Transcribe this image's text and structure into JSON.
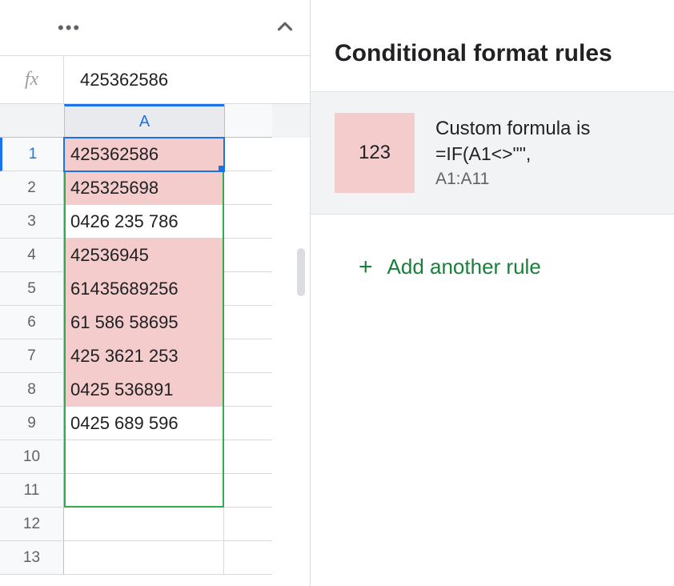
{
  "formula_bar": {
    "fx_label": "fx",
    "value": "425362586"
  },
  "columns": [
    "A"
  ],
  "rows": [
    {
      "n": 1,
      "value": "425362586",
      "highlight": true,
      "active": true
    },
    {
      "n": 2,
      "value": "425325698",
      "highlight": true
    },
    {
      "n": 3,
      "value": "0426 235 786",
      "highlight": false
    },
    {
      "n": 4,
      "value": "42536945",
      "highlight": true
    },
    {
      "n": 5,
      "value": "61435689256",
      "highlight": true
    },
    {
      "n": 6,
      "value": "61 586 58695",
      "highlight": true
    },
    {
      "n": 7,
      "value": "425 3621 253",
      "highlight": true
    },
    {
      "n": 8,
      "value": "0425 536891",
      "highlight": true
    },
    {
      "n": 9,
      "value": "0425 689 596",
      "highlight": false
    },
    {
      "n": 10,
      "value": "",
      "highlight": false
    },
    {
      "n": 11,
      "value": "",
      "highlight": false
    },
    {
      "n": 12,
      "value": "",
      "highlight": false
    },
    {
      "n": 13,
      "value": "",
      "highlight": false
    }
  ],
  "panel": {
    "title": "Conditional format rules",
    "rule": {
      "preview_text": "123",
      "preview_bg": "#f4cccc",
      "line1": "Custom formula is",
      "line2": "=IF(A1<>\"\",",
      "range": "A1:A11"
    },
    "add_label": "Add another rule"
  }
}
